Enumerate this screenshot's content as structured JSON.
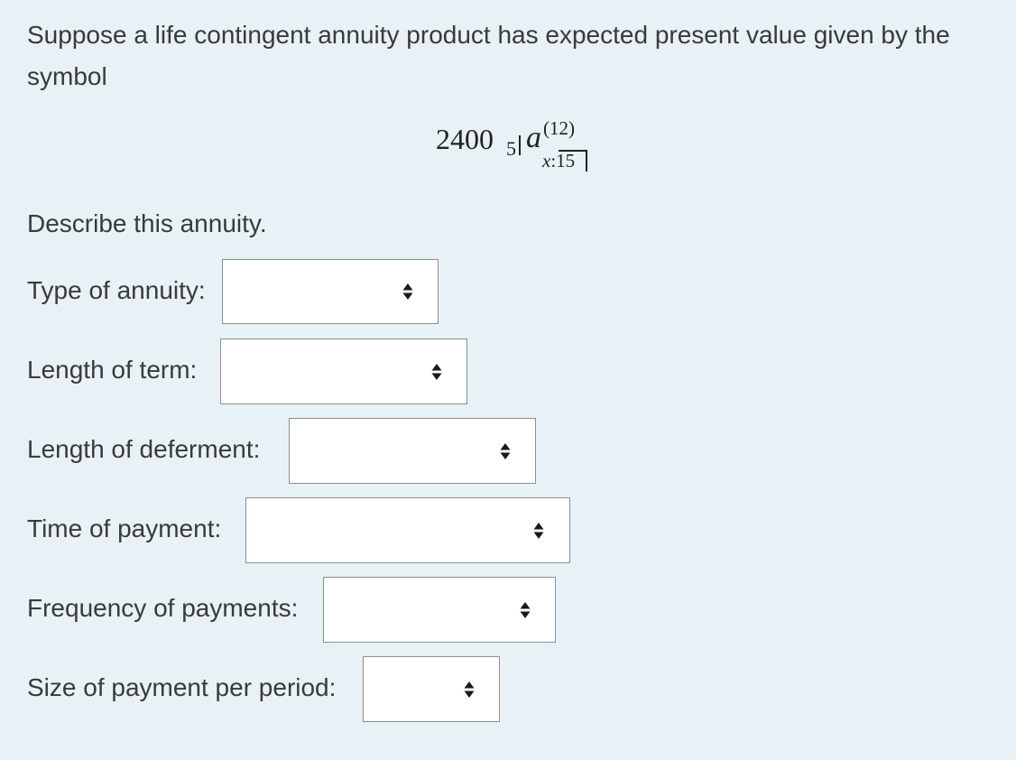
{
  "question": {
    "intro": "Suppose a life contingent annuity product has expected present value given by the symbol",
    "describe": "Describe this annuity."
  },
  "formula": {
    "coefficient": "2400",
    "deferment": "5",
    "symbol": "a",
    "superscript": "(12)",
    "subscript_x": "x",
    "subscript_sep": ":",
    "subscript_term": "15"
  },
  "fields": [
    {
      "label": "Type of annuity:",
      "selected": ""
    },
    {
      "label": "Length of term:",
      "selected": ""
    },
    {
      "label": "Length of deferment:",
      "selected": ""
    },
    {
      "label": "Time of payment:",
      "selected": ""
    },
    {
      "label": "Frequency of payments:",
      "selected": ""
    },
    {
      "label": "Size of payment per period:",
      "selected": ""
    }
  ],
  "icons": {
    "select_arrow": "up-down-arrows-icon"
  },
  "colors": {
    "background": "#e8f1f5",
    "select_border": "#8a8f94"
  }
}
